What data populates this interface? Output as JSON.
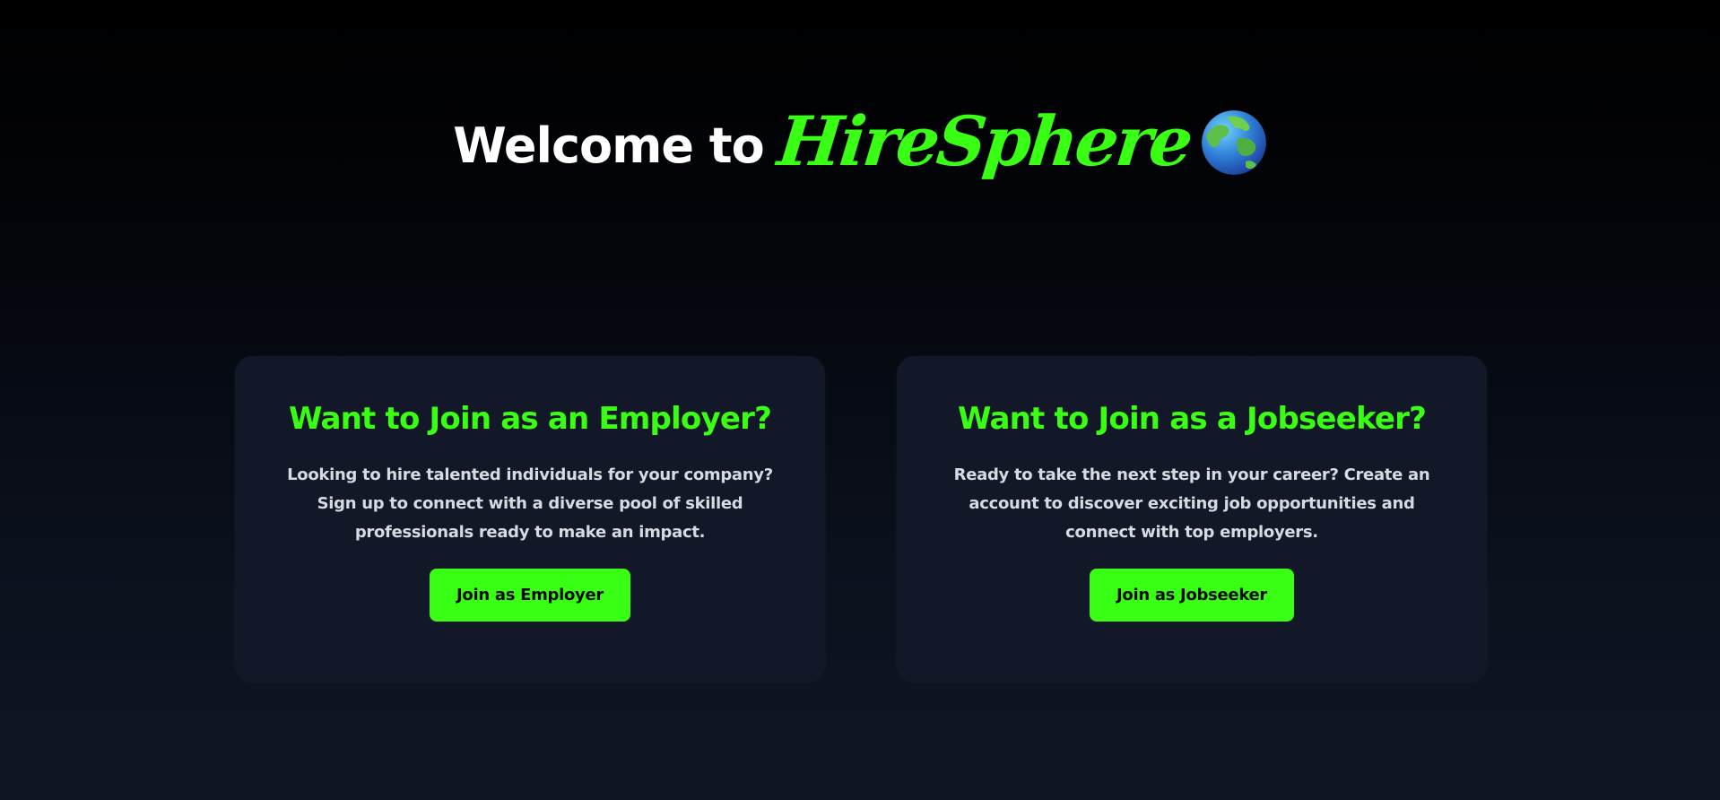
{
  "hero": {
    "welcome": "Welcome to",
    "brand": "HireSphere",
    "globe_icon": "globe-icon",
    "brand_color": "#39ff14"
  },
  "employer_card": {
    "title": "Want to Join as an Employer?",
    "description": "Looking to hire talented individuals for your company? Sign up to connect with a diverse pool of skilled professionals ready to make an impact.",
    "button_label": "Join as Employer"
  },
  "jobseeker_card": {
    "title": "Want to Join as a Jobseeker?",
    "description": "Ready to take the next step in your career? Create an account to discover exciting job opportunities and connect with top employers.",
    "button_label": "Join as Jobseeker"
  },
  "colors": {
    "accent": "#39ff14",
    "card_background": "#121828",
    "page_background_top": "#000000",
    "page_background_bottom": "#0f1523"
  }
}
